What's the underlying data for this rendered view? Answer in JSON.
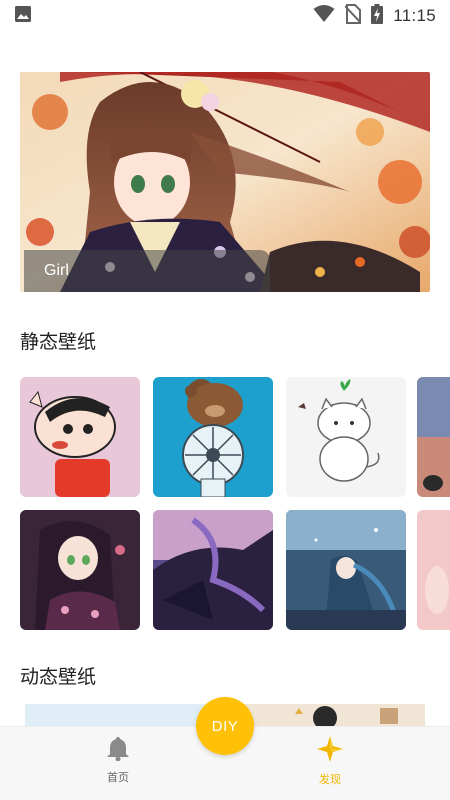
{
  "status_bar": {
    "time": "11:15",
    "icons": [
      "image-icon",
      "wifi-icon",
      "no-sim-icon",
      "battery-charging-icon"
    ]
  },
  "banner": {
    "caption": "Girl"
  },
  "static_section": {
    "title": "静态壁纸",
    "rows": [
      [
        "cartoon-boy-wallpaper",
        "bear-with-fan-wallpaper",
        "white-cat-wallpaper",
        "sunset-cat-wallpaper"
      ],
      [
        "kimono-girl-wallpaper",
        "dark-dragon-wallpaper",
        "blue-hair-girl-wallpaper",
        "pink-anime-wallpaper"
      ]
    ]
  },
  "dynamic_section": {
    "title": "动态壁纸"
  },
  "fab": {
    "label": "DIY",
    "color": "#ffc107"
  },
  "bottom_nav": {
    "items": [
      {
        "label": "首页",
        "icon": "bell-icon",
        "active": false
      },
      {
        "label": "发现",
        "icon": "star-diamond-icon",
        "active": true
      }
    ],
    "active_color": "#f2b600"
  }
}
